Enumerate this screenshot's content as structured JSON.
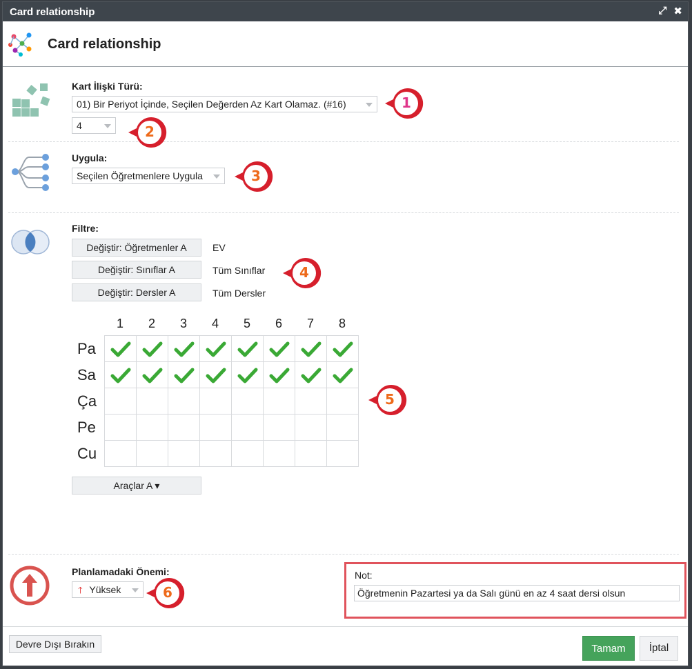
{
  "window": {
    "title": "Card relationship"
  },
  "header": {
    "title": "Card relationship"
  },
  "relation": {
    "label": "Kart İlişki Türü:",
    "type_value": "01) Bir Periyot İçinde, Seçilen Değerden Az Kart Olamaz. (#16)",
    "count_value": "4"
  },
  "apply": {
    "label": "Uygula:",
    "value": "Seçilen Öğretmenlere Uygula"
  },
  "filter": {
    "label": "Filtre:",
    "rows": [
      {
        "button": "Değiştir: Öğretmenler A",
        "value": "EV"
      },
      {
        "button": "Değiştir: Sınıflar A",
        "value": "Tüm Sınıflar"
      },
      {
        "button": "Değiştir: Dersler A",
        "value": "Tüm Dersler"
      }
    ]
  },
  "grid": {
    "columns": [
      "1",
      "2",
      "3",
      "4",
      "5",
      "6",
      "7",
      "8"
    ],
    "rows": [
      "Pa",
      "Sa",
      "Ça",
      "Pe",
      "Cu"
    ],
    "checked": [
      [
        true,
        true,
        true,
        true,
        true,
        true,
        true,
        true
      ],
      [
        true,
        true,
        true,
        true,
        true,
        true,
        true,
        true
      ],
      [
        false,
        false,
        false,
        false,
        false,
        false,
        false,
        false
      ],
      [
        false,
        false,
        false,
        false,
        false,
        false,
        false,
        false
      ],
      [
        false,
        false,
        false,
        false,
        false,
        false,
        false,
        false
      ]
    ]
  },
  "tools": {
    "label": "Araçlar A ▾"
  },
  "importance": {
    "label": "Planlamadaki Önemi:",
    "value": "Yüksek"
  },
  "note": {
    "label": "Not:",
    "value": "Öğretmenin Pazartesi ya da Salı günü en az 4 saat dersi olsun"
  },
  "badges": [
    "1",
    "2",
    "3",
    "4",
    "5",
    "6"
  ],
  "footer": {
    "disable_label": "Devre Dışı Bırakın",
    "ok_label": "Tamam",
    "cancel_label": "İptal"
  },
  "colors": {
    "titlebar": "#3e454c",
    "ok_button": "#45a35b",
    "badge_red": "#d61f2c",
    "check_green": "#3aa935",
    "highlight_border": "#e0535c"
  }
}
